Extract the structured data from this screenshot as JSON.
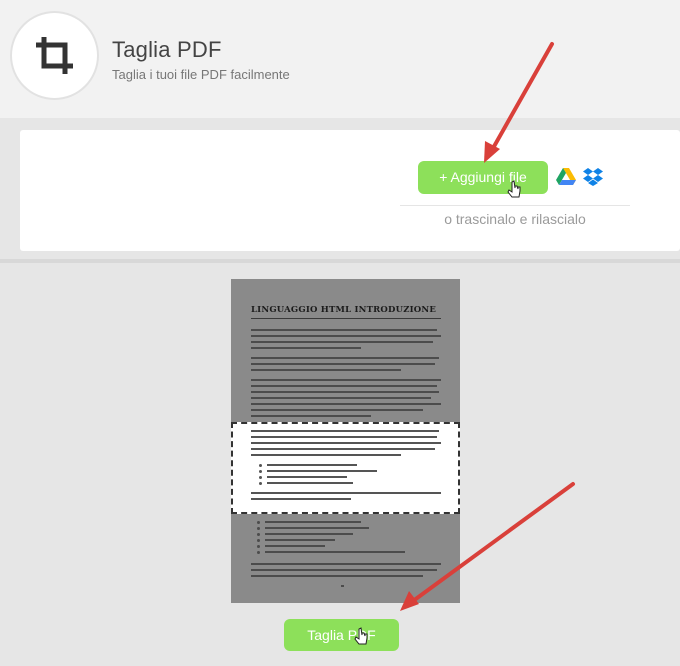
{
  "header": {
    "title": "Taglia PDF",
    "subtitle": "Taglia i tuoi file PDF facilmente",
    "logo_icon": "crop-icon"
  },
  "upload": {
    "add_label": "+ Aggiungi file",
    "drop_text": "o trascinalo e rilascialo",
    "cloud_icons": [
      "google-drive-icon",
      "dropbox-icon"
    ]
  },
  "document": {
    "title": "LINGUAGGIO HTML INTRODUZIONE"
  },
  "action": {
    "cut_label": "Taglia PDF"
  },
  "colors": {
    "button_green": "#8de05a",
    "annotation_arrow": "#d9403a"
  }
}
